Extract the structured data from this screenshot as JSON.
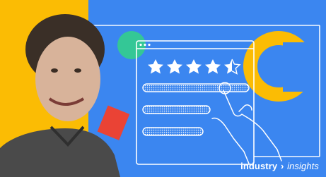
{
  "colors": {
    "background_blue": "#3b86f0",
    "accent_yellow": "#fbbc04",
    "accent_red": "#ea4335",
    "accent_green": "#34c796",
    "line_white": "#ffffff"
  },
  "rating": {
    "value": 4.5,
    "max": 5
  },
  "icons": [
    "star-icon",
    "hand-pointer-icon",
    "window-dots-icon"
  ],
  "brand": {
    "strong": "industry",
    "chevron": "›",
    "light": "insights"
  }
}
